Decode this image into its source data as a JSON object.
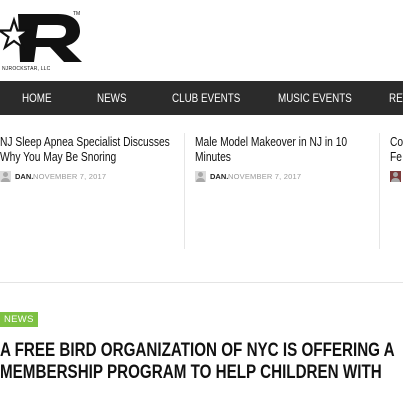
{
  "brand": {
    "name": "NJROCKSTAR, LLC",
    "trademark": "TM",
    "logo_icon": "njrockstar-star-r-logo"
  },
  "nav": {
    "items": [
      {
        "label": "HOME"
      },
      {
        "label": "NEWS"
      },
      {
        "label": "CLUB EVENTS"
      },
      {
        "label": "MUSIC EVENTS"
      },
      {
        "label": "REV"
      }
    ]
  },
  "ticker": {
    "items": [
      {
        "title_line1": "NJ Sleep Apnea Specialist Discusses",
        "title_line2": "Why You May Be Snoring",
        "author": "DAN.",
        "date": "NOVEMBER 7, 2017"
      },
      {
        "title_line1": "Male Model Makeover in NJ in 10",
        "title_line2": "Minutes",
        "author": "DAN.",
        "date": "NOVEMBER 7, 2017"
      },
      {
        "title_line1": "Co",
        "title_line2": "Fe"
      }
    ]
  },
  "article": {
    "category": "NEWS",
    "headline_line1": "A FREE BIRD ORGANIZATION OF NYC IS OFFERING A",
    "headline_line2": "MEMBERSHIP PROGRAM TO HELP CHILDREN WITH"
  },
  "colors": {
    "nav_bg": "#2b2b2b",
    "badge_bg": "#7dc142",
    "meta_gray": "#9a9a9a"
  }
}
